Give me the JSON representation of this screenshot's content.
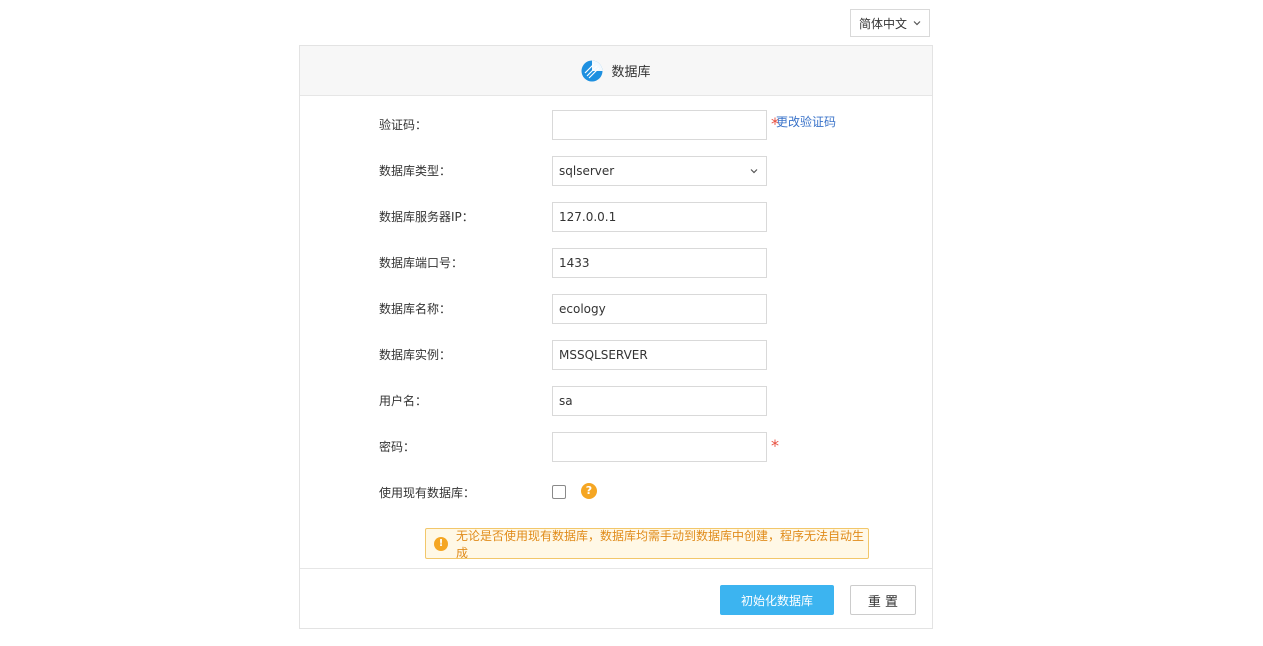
{
  "language": {
    "selected": "简体中文"
  },
  "header": {
    "title": "数据库",
    "logo_icon": "pie-chart-logo-icon"
  },
  "form": {
    "captcha": {
      "label": "验证码：",
      "value": "",
      "required_mark": "*",
      "change_link": "更改验证码"
    },
    "db_type": {
      "label": "数据库类型：",
      "value": "sqlserver"
    },
    "db_ip": {
      "label": "数据库服务器IP：",
      "value": "127.0.0.1"
    },
    "db_port": {
      "label": "数据库端口号：",
      "value": "1433"
    },
    "db_name": {
      "label": "数据库名称：",
      "value": "ecology"
    },
    "db_instance": {
      "label": "数据库实例：",
      "value": "MSSQLSERVER"
    },
    "username": {
      "label": "用户名：",
      "value": "sa"
    },
    "password": {
      "label": "密码：",
      "value": "",
      "required_mark": "*"
    },
    "use_existing": {
      "label": "使用现有数据库：",
      "checked": false,
      "help_glyph": "?"
    }
  },
  "notice": {
    "icon_glyph": "!",
    "text": "无论是否使用现有数据库，数据库均需手动到数据库中创建，程序无法自动生成"
  },
  "buttons": {
    "init": "初始化数据库",
    "reset": "重 置"
  },
  "colors": {
    "primary": "#3cb4f0",
    "required": "#e74c3c",
    "warning": "#f5a623",
    "link": "#3a73c9"
  }
}
